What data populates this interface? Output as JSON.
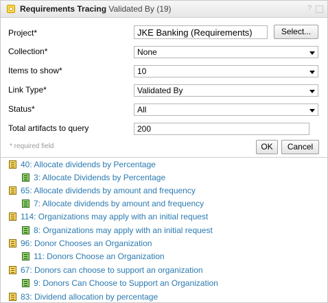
{
  "title": {
    "main": "Requirements Tracing",
    "sub": "Validated By (19)"
  },
  "form": {
    "project_label": "Project*",
    "project_value": "JKE Banking (Requirements)",
    "select_button": "Select...",
    "collection_label": "Collection*",
    "collection_value": "None",
    "items_label": "Items to show*",
    "items_value": "10",
    "linktype_label": "Link Type*",
    "linktype_value": "Validated By",
    "status_label": "Status*",
    "status_value": "All",
    "total_label": "Total artifacts to query",
    "total_value": "200",
    "required_note": "* required field",
    "ok_button": "OK",
    "cancel_button": "Cancel"
  },
  "results": [
    {
      "text": "40: Allocate dividends by Percentage",
      "level": 1,
      "icon": "requirement-icon"
    },
    {
      "text": "3: Allocate Dividends by Percentage",
      "level": 2,
      "icon": "test-case-icon"
    },
    {
      "text": "65: Allocate dividends by amount and frequency",
      "level": 1,
      "icon": "requirement-icon"
    },
    {
      "text": "7: Allocate dividends by amount and frequency",
      "level": 2,
      "icon": "test-case-icon"
    },
    {
      "text": "114: Organizations may apply with an initial request",
      "level": 1,
      "icon": "requirement-icon"
    },
    {
      "text": "8: Organizations may apply with an initial request",
      "level": 2,
      "icon": "test-case-icon"
    },
    {
      "text": "96: Donor Chooses an Organization",
      "level": 1,
      "icon": "requirement-icon"
    },
    {
      "text": "11: Donors Choose an Organization",
      "level": 2,
      "icon": "test-case-icon"
    },
    {
      "text": "67: Donors can choose to support an organization",
      "level": 1,
      "icon": "requirement-icon"
    },
    {
      "text": "9: Donors Can Choose to Support an Organization",
      "level": 2,
      "icon": "test-case-icon"
    },
    {
      "text": "83: Dividend allocation by percentage",
      "level": 1,
      "icon": "requirement-icon"
    }
  ]
}
